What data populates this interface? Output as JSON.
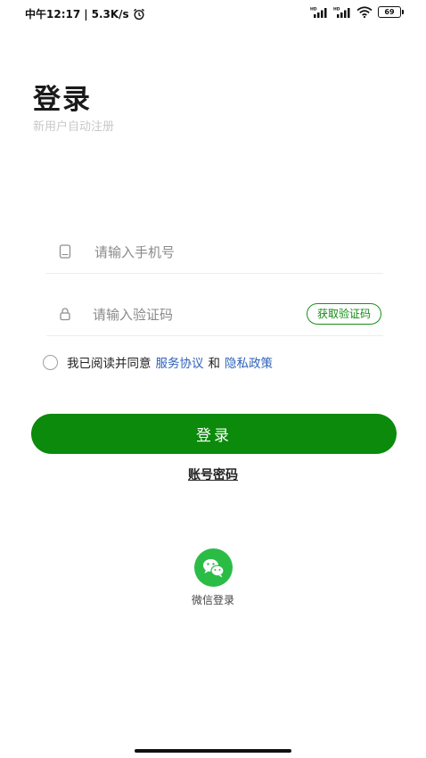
{
  "status_bar": {
    "carrier_time": "中午12:17",
    "separator": "|",
    "net_speed": "5.3K/s",
    "battery": "69",
    "icons": [
      "alarm-icon",
      "hd-signal-icon",
      "hd-signal-icon",
      "wifi-icon",
      "battery-icon"
    ]
  },
  "header": {
    "title": "登录",
    "subtitle": "新用户自动注册"
  },
  "form": {
    "phone": {
      "placeholder": "请输入手机号",
      "value": "",
      "icon": "phone-icon"
    },
    "code": {
      "placeholder": "请输入验证码",
      "value": "",
      "icon": "lock-icon",
      "get_code_label": "获取验证码"
    }
  },
  "agreement": {
    "prefix": "我已阅读并同意",
    "service_link": "服务协议",
    "conjunction": "和",
    "privacy_link": "隐私政策",
    "checked": false
  },
  "actions": {
    "login_label": "登录",
    "password_login_label": "账号密码"
  },
  "third_party": {
    "wechat_label": "微信登录",
    "wechat_color": "#2bbc46"
  },
  "colors": {
    "primary_green": "#0b8a0b",
    "link_blue": "#2f62b8"
  }
}
